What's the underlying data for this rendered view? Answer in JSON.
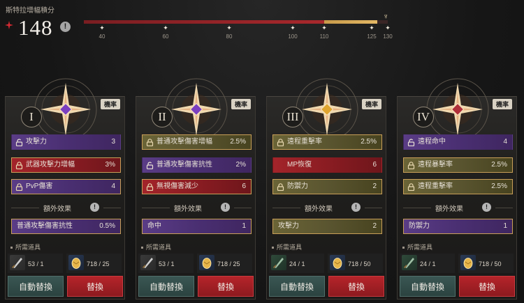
{
  "header": {
    "title": "斯特拉增幅積分",
    "value": "148",
    "info_icon": "info-icon",
    "accent": "#c8262d",
    "milestones": [
      {
        "label": "40"
      },
      {
        "label": "60"
      },
      {
        "label": "80"
      },
      {
        "label": "100"
      },
      {
        "label": "110"
      },
      {
        "label": "125"
      },
      {
        "label": "130"
      }
    ],
    "scale_max": 130,
    "gold_segment_start": 110
  },
  "cards": [
    {
      "numeral": "I",
      "rate_label": "機率",
      "gem_color": "#7b3fbf",
      "stats": [
        {
          "name": "攻擊力",
          "value": "3",
          "color": "purple",
          "lock": "unlocked-icon"
        },
        {
          "name": "武器攻擊力增幅",
          "value": "3%",
          "color": "red",
          "lock": "lock-icon"
        },
        {
          "name": "PvP傷害",
          "value": "4",
          "color": "purple",
          "lock": "lock-icon"
        }
      ],
      "extra_label": "額外效果",
      "extra": {
        "name": "普通攻擊傷害抗性",
        "value": "0.5%",
        "color": "purple"
      },
      "materials_label": "所需道具",
      "materials": [
        {
          "icon": "dagger-icon",
          "qty": "53 / 1"
        },
        {
          "icon": "golden-egg-icon",
          "qty": "718 / 25"
        }
      ],
      "auto_label": "自動替換",
      "swap_label": "替換"
    },
    {
      "numeral": "II",
      "rate_label": "機率",
      "gem_color": "#7b3fbf",
      "stats": [
        {
          "name": "普通攻擊傷害增幅",
          "value": "2.5%",
          "color": "olive",
          "lock": "lock-icon"
        },
        {
          "name": "普通攻擊傷害抗性",
          "value": "2%",
          "color": "purple",
          "lock": "unlocked-icon"
        },
        {
          "name": "無視傷害減少",
          "value": "6",
          "color": "red",
          "lock": "lock-icon"
        }
      ],
      "extra_label": "額外效果",
      "extra": {
        "name": "命中",
        "value": "1",
        "color": "purple"
      },
      "materials_label": "所需道具",
      "materials": [
        {
          "icon": "dagger-icon",
          "qty": "53 / 1"
        },
        {
          "icon": "golden-egg-icon",
          "qty": "718 / 25"
        }
      ],
      "auto_label": "自動替換",
      "swap_label": "替換"
    },
    {
      "numeral": "III",
      "rate_label": "機率",
      "gem_color": "#e0a530",
      "stats": [
        {
          "name": "遠程重擊率",
          "value": "2.5%",
          "color": "olive",
          "lock": "lock-icon"
        },
        {
          "name": "MP恢復",
          "value": "6",
          "color": "red",
          "lock": "none"
        },
        {
          "name": "防禦力",
          "value": "2",
          "color": "olive",
          "lock": "lock-icon"
        }
      ],
      "extra_label": "額外效果",
      "extra": {
        "name": "攻擊力",
        "value": "2",
        "color": "olive"
      },
      "materials_label": "所需道具",
      "materials": [
        {
          "icon": "green-blade-icon",
          "qty": "24 / 1"
        },
        {
          "icon": "golden-egg-icon",
          "qty": "718 / 50"
        }
      ],
      "auto_label": "自動替換",
      "swap_label": "替換"
    },
    {
      "numeral": "IV",
      "rate_label": "機率",
      "gem_color": "#b0303a",
      "stats": [
        {
          "name": "遠程命中",
          "value": "4",
          "color": "purple",
          "lock": "unlocked-icon"
        },
        {
          "name": "遠程暴擊率",
          "value": "2.5%",
          "color": "olive",
          "lock": "lock-icon"
        },
        {
          "name": "遠程重擊率",
          "value": "2.5%",
          "color": "olive",
          "lock": "lock-icon"
        }
      ],
      "extra_label": "額外效果",
      "extra": {
        "name": "防禦力",
        "value": "1",
        "color": "purple"
      },
      "materials_label": "所需道具",
      "materials": [
        {
          "icon": "green-blade-icon",
          "qty": "24 / 1"
        },
        {
          "icon": "golden-egg-icon",
          "qty": "718 / 50"
        }
      ],
      "auto_label": "自動替換",
      "swap_label": "替換"
    }
  ]
}
